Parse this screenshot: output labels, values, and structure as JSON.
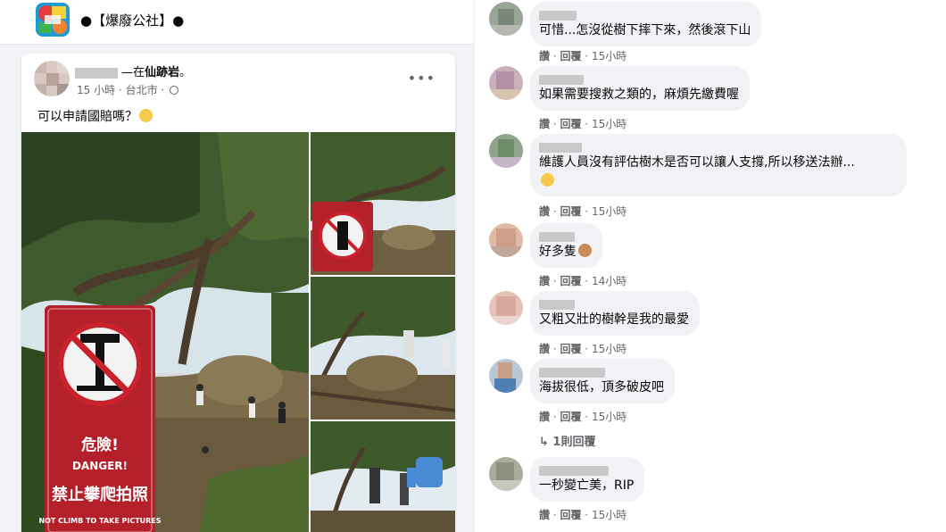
{
  "group": {
    "name": "●【爆廢公社】●"
  },
  "post": {
    "author_suffix": "—在",
    "place": "仙跡岩",
    "place_suffix": "。",
    "time": "15 小時",
    "location": "台北市",
    "separator": "·",
    "text": "可以申請國賠嗎？",
    "more": "•••"
  },
  "sign": {
    "line1": "危險!",
    "line2": "DANGER!",
    "line3": "禁止攀爬拍照",
    "line4": "NOT CLIMB TO TAKE PICTURES"
  },
  "comments": [
    {
      "text": "可惜...怎沒從樹下摔下來，然後滾下山",
      "read": "讚",
      "reply": "回覆",
      "time": "15小時"
    },
    {
      "text": "如果需要搜救之類的，麻煩先繳費喔",
      "read": "讚",
      "reply": "回覆",
      "time": "15小時"
    },
    {
      "text": "維護人員沒有評估樹木是否可以讓人支撐,所以移送法辦...",
      "read": "讚",
      "reply": "回覆",
      "time": "15小時"
    },
    {
      "text": "好多隻",
      "read": "讚",
      "reply": "回覆",
      "time": "14小時"
    },
    {
      "text": "又粗又壯的樹幹是我的最愛",
      "read": "讚",
      "reply": "回覆",
      "time": "15小時"
    },
    {
      "text": "海拔很低，頂多破皮吧",
      "read": "讚",
      "reply": "回覆",
      "time": "15小時"
    },
    {
      "text": "一秒變亡美，RIP",
      "read": "讚",
      "reply": "回覆",
      "time": "15小時"
    }
  ],
  "replies_link": "↳ 1則回覆",
  "dot": " · "
}
